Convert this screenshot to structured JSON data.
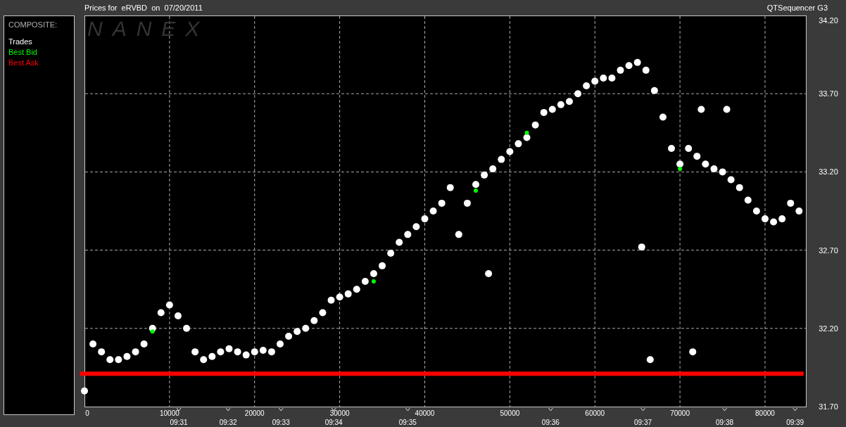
{
  "header": {
    "title": "Prices for  eRVBD  on  07/20/2011",
    "app_name": "QTSequencer G3"
  },
  "legend": {
    "title": "COMPOSITE:"
  },
  "chart": {
    "logo": "NANEX",
    "time_axis": [
      {
        "label": "09:31"
      },
      {
        "label": "09:32"
      },
      {
        "label": "09:33"
      },
      {
        "label": "09:34"
      },
      {
        "label": "09:35"
      },
      {
        "label": "09:36"
      },
      {
        "label": "09:37"
      },
      {
        "label": "09:38"
      },
      {
        "label": "09:39"
      }
    ],
    "chart_data": {
      "type": "scatter",
      "grid": true,
      "xlim": [
        0,
        84800
      ],
      "ylim": [
        31.7,
        34.2
      ],
      "xticks": [
        {
          "value": 0,
          "label": "0"
        },
        {
          "value": 10000,
          "label": "10000"
        },
        {
          "value": 20000,
          "label": "20000"
        },
        {
          "value": 30000,
          "label": "30000"
        },
        {
          "value": 40000,
          "label": "40000"
        },
        {
          "value": 50000,
          "label": "50000"
        },
        {
          "value": 60000,
          "label": "60000"
        },
        {
          "value": 70000,
          "label": "70000"
        },
        {
          "value": 80000,
          "label": "80000"
        }
      ],
      "yticks": [
        {
          "value": 31.7,
          "label": "31.70"
        },
        {
          "value": 32.2,
          "label": "32.20"
        },
        {
          "value": 32.7,
          "label": "32.70"
        },
        {
          "value": 33.2,
          "label": "33.20"
        },
        {
          "value": 33.7,
          "label": "33.70"
        },
        {
          "value": 34.2,
          "label": "34.20"
        }
      ],
      "x": [
        0,
        1000,
        2000,
        3000,
        4000,
        5000,
        6000,
        7000,
        8000,
        9000,
        10000,
        11000,
        12000,
        13000,
        14000,
        15000,
        16000,
        17000,
        18000,
        19000,
        20000,
        21000,
        22000,
        23000,
        24000,
        25000,
        26000,
        27000,
        28000,
        29000,
        30000,
        31000,
        32000,
        33000,
        34000,
        35000,
        36000,
        37000,
        38000,
        39000,
        40000,
        41000,
        42000,
        43000,
        44000,
        45000,
        46000,
        47000,
        48000,
        49000,
        50000,
        51000,
        52000,
        53000,
        54000,
        55000,
        56000,
        57000,
        58000,
        59000,
        60000,
        61000,
        62000,
        63000,
        64000,
        65000,
        66000,
        67000,
        68000,
        69000,
        70000,
        71000,
        72000,
        73000,
        74000,
        75000,
        76000,
        77000,
        78000,
        79000,
        80000,
        81000,
        82000,
        83000,
        84000,
        47500,
        65500,
        66500,
        71500,
        72500,
        75500
      ],
      "series": [
        {
          "name": "Trades",
          "color": "#ffffff",
          "marker": "circle",
          "values": [
            31.8,
            32.1,
            32.05,
            32.0,
            32.0,
            32.02,
            32.05,
            32.1,
            32.2,
            32.3,
            32.35,
            32.28,
            32.2,
            32.05,
            32.0,
            32.02,
            32.05,
            32.07,
            32.05,
            32.03,
            32.05,
            32.06,
            32.05,
            32.1,
            32.15,
            32.18,
            32.2,
            32.25,
            32.3,
            32.38,
            32.4,
            32.42,
            32.45,
            32.5,
            32.55,
            32.6,
            32.68,
            32.75,
            32.8,
            32.85,
            32.9,
            32.95,
            33.0,
            33.1,
            32.8,
            33.0,
            33.12,
            33.18,
            33.22,
            33.28,
            33.33,
            33.38,
            33.42,
            33.5,
            33.58,
            33.6,
            33.63,
            33.65,
            33.7,
            33.75,
            33.78,
            33.8,
            33.8,
            33.85,
            33.88,
            33.9,
            33.85,
            33.72,
            33.55,
            33.35,
            33.25,
            33.35,
            33.3,
            33.25,
            33.22,
            33.2,
            33.15,
            33.1,
            33.02,
            32.95,
            32.9,
            32.88,
            32.9,
            33.0,
            32.95,
            32.55,
            32.72,
            32.0,
            32.05,
            33.6,
            33.6
          ]
        },
        {
          "name": "Best Bid",
          "color": "#00ff00",
          "marker": "circle",
          "values": [
            null,
            null,
            null,
            null,
            null,
            null,
            null,
            null,
            32.18,
            null,
            null,
            null,
            null,
            null,
            null,
            null,
            null,
            null,
            null,
            null,
            null,
            null,
            null,
            null,
            null,
            null,
            null,
            null,
            null,
            null,
            null,
            null,
            null,
            null,
            32.5,
            null,
            null,
            null,
            null,
            null,
            null,
            null,
            null,
            null,
            null,
            null,
            33.08,
            null,
            null,
            null,
            null,
            null,
            33.45,
            null,
            null,
            null,
            null,
            null,
            null,
            null,
            null,
            null,
            null,
            null,
            null,
            null,
            null,
            null,
            null,
            null,
            33.22,
            null,
            null,
            null,
            null,
            null,
            null,
            null,
            null,
            null,
            null,
            null,
            null,
            null,
            null,
            null,
            null,
            null,
            null,
            null,
            null
          ]
        },
        {
          "name": "Best Ask",
          "color": "#ff0000",
          "marker": "square",
          "values": [
            31.91,
            31.91,
            31.91,
            31.91,
            31.91,
            31.91,
            31.91,
            31.91,
            31.91,
            31.91,
            31.91,
            31.91,
            31.91,
            31.91,
            31.91,
            31.91,
            31.91,
            31.91,
            31.91,
            31.91,
            31.91,
            31.91,
            31.91,
            31.91,
            31.91,
            31.91,
            31.91,
            31.91,
            31.91,
            31.91,
            31.91,
            31.91,
            31.91,
            31.91,
            31.91,
            31.91,
            31.91,
            31.91,
            31.91,
            31.91,
            31.91,
            31.91,
            31.91,
            31.91,
            31.91,
            31.91,
            31.91,
            31.91,
            31.91,
            31.91,
            31.91,
            31.91,
            31.91,
            31.91,
            31.91,
            31.91,
            31.91,
            31.91,
            31.91,
            31.91,
            31.91,
            31.91,
            31.91,
            31.91,
            31.91,
            31.91,
            31.91,
            31.91,
            31.91,
            31.91,
            31.91,
            31.91,
            31.91,
            31.91,
            31.91,
            31.91,
            31.91,
            31.91,
            31.91,
            31.91,
            31.91,
            31.91,
            31.91,
            31.91,
            31.91,
            null,
            null,
            null,
            null,
            null,
            null
          ]
        }
      ]
    }
  }
}
